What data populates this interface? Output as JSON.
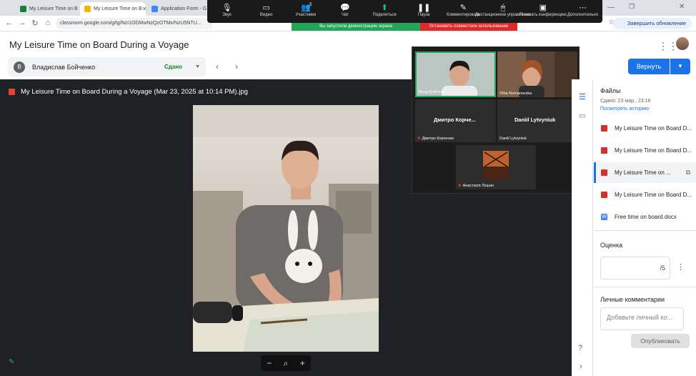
{
  "browser": {
    "tabs": [
      {
        "label": "My Leisure Time on B",
        "color": "#188038"
      },
      {
        "label": "My Leisure Time on B",
        "color": "#f4b400"
      },
      {
        "label": "Application Form - G",
        "color": "#4285f4"
      }
    ],
    "url": "classroom.google.com/g/tg/NzI1ODMwNzQzOTMx/NzU5NTU...",
    "update_label": "Завершить обновление"
  },
  "zoom_toolbar": {
    "buttons": [
      {
        "icon": "mic-icon",
        "glyph": "🎙",
        "label": "Звук"
      },
      {
        "icon": "video-icon",
        "glyph": "▭",
        "label": "Видео"
      },
      {
        "icon": "participants-icon",
        "glyph": "👥",
        "label": "Участники",
        "badge": "5"
      },
      {
        "icon": "chat-icon",
        "glyph": "💬",
        "label": "Чат"
      },
      {
        "icon": "share-icon",
        "glyph": "⬆",
        "label": "Поделиться"
      },
      {
        "icon": "pause-icon",
        "glyph": "❚❚",
        "label": "Пауза"
      },
      {
        "icon": "annotate-icon",
        "glyph": "✎",
        "label": "Комментировать"
      },
      {
        "icon": "remote-control-icon",
        "glyph": "🖱",
        "label": "Дистанционное управление"
      },
      {
        "icon": "show-conference-icon",
        "glyph": "▣",
        "label": "Показать конференцию"
      },
      {
        "icon": "more-icon",
        "glyph": "⋯",
        "label": "Дополнительно"
      }
    ],
    "sharing_notice": "Вы запустили демонстрацию экрана",
    "stop_sharing": "Остановить совместное использование"
  },
  "classroom": {
    "title": "My Leisure Time on Board During a Voyage",
    "student_initial": "В",
    "student_name": "Владислав Бойченко",
    "status": "Сдано",
    "return_label": "Вернуть"
  },
  "viewer": {
    "file_title": "My Leisure Time on Board During a Voyage (Mar 23, 2025 at 10:14 PM).jpg",
    "zoom_minus": "−",
    "zoom_plus": "+"
  },
  "video_panel": {
    "tiles": [
      {
        "name": "Влад Бойченко"
      },
      {
        "name": "Olha Romanovska"
      },
      {
        "name": "Дмитро Корче...",
        "label": "Дмитро Корченко"
      },
      {
        "name": "Daniil Lytvyniuk",
        "label": "Daniil Lytvyniuk"
      },
      {
        "name": "Анастасія Лєшан"
      }
    ]
  },
  "files_panel": {
    "heading": "Файлы",
    "submitted": "Сдано: 23 мар., 23:16",
    "history_link": "Посмотреть историю",
    "files": [
      {
        "name": "My Leisure Time on Board D...",
        "type": "image",
        "color": "#d93025"
      },
      {
        "name": "My Leisure Time on Board D...",
        "type": "image",
        "color": "#d93025"
      },
      {
        "name": "My Leisure Time on ...",
        "type": "image",
        "color": "#d93025",
        "selected": true
      },
      {
        "name": "My Leisure Time on Board D...",
        "type": "image",
        "color": "#d93025"
      },
      {
        "name": "Free time on board.docx",
        "type": "doc",
        "color": "#4285f4"
      }
    ],
    "grade_heading": "Оценка",
    "grade_value": "/5",
    "comments_heading": "Личные комментарии",
    "comment_placeholder": "Добавьте личный ко...",
    "publish_label": "Опубликовать"
  }
}
